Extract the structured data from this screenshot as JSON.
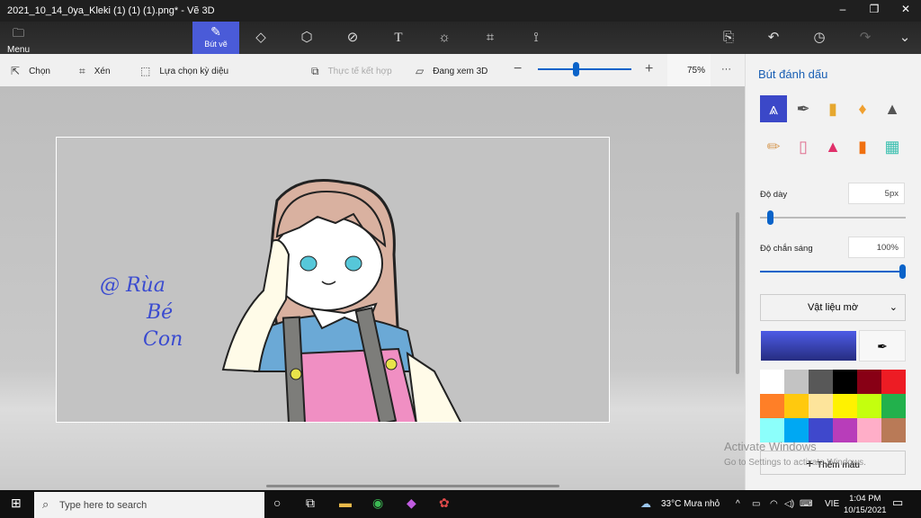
{
  "window": {
    "title": "2021_10_14_0ya_Kleki (1) (1) (1).png* - Vẽ 3D",
    "minimize": "–",
    "maximize": "❐",
    "close": "✕"
  },
  "toolbar": {
    "menu_label": "Menu",
    "active_tool_label": "Bút vẽ",
    "tools": [
      "2d-shapes",
      "3d-shapes",
      "stickers",
      "text",
      "effects",
      "canvas",
      "3d-library"
    ],
    "right_icons": [
      "paste",
      "undo",
      "history",
      "redo",
      "expand"
    ]
  },
  "subtoolbar": {
    "select": "Chọn",
    "crop": "Xén",
    "magic_select": "Lựa chọn kỳ diệu",
    "mixed_reality": "Thực tế kết hợp",
    "view_3d": "Đang xem 3D",
    "zoom_percent": "75%",
    "zoom_level": 0.4,
    "more": "···"
  },
  "canvas": {
    "signature_lines": [
      "@ Rùa",
      "Bé",
      "Con"
    ]
  },
  "panel": {
    "title": "Bút đánh dấu",
    "brushes": [
      "marker",
      "calligraphy-pen",
      "oil-brush",
      "watercolor",
      "pixel-pen",
      "pencil",
      "eraser",
      "crayon",
      "spray-can",
      "fill"
    ],
    "thickness_label": "Độ dày",
    "thickness_value": "5px",
    "thickness_level": 0.05,
    "opacity_label": "Độ chắn sáng",
    "opacity_value": "100%",
    "opacity_level": 1.0,
    "material": "Vật liệu mờ",
    "current_color": "#3b48c8",
    "palette": [
      "#ffffff",
      "#c3c3c3",
      "#585858",
      "#000000",
      "#880015",
      "#ed1c24",
      "#ff7f27",
      "#ffc90e",
      "#fde49b",
      "#fff200",
      "#c4ff0e",
      "#22b14c",
      "#8cfffb",
      "#00a8f3",
      "#3f48cc",
      "#b83dba",
      "#ffaec8",
      "#b97a57"
    ],
    "add_color": "Thêm màu"
  },
  "watermark": {
    "line1": "Activate Windows",
    "line2": "Go to Settings to activate Windows."
  },
  "taskbar": {
    "search_placeholder": "Type here to search",
    "weather": "33°C  Mưa nhỏ",
    "language": "VIE",
    "time": "1:04 PM",
    "date": "10/15/2021"
  }
}
